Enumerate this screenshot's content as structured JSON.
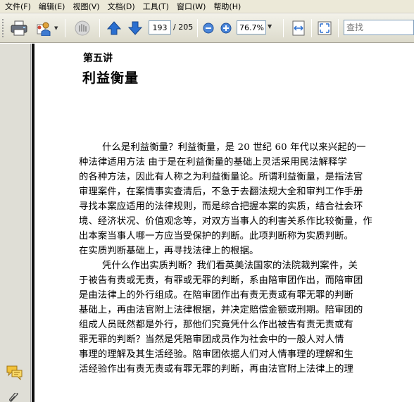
{
  "menu": [
    "文件(F)",
    "编辑(E)",
    "视图(V)",
    "文档(D)",
    "工具(T)",
    "窗口(W)",
    "帮助(H)"
  ],
  "toolbar": {
    "page_current": "193",
    "page_total": "/ 205",
    "zoom": "76.7%",
    "search_placeholder": "查找",
    "accent": "#2a6fd0"
  },
  "document": {
    "lecture_number": "第五讲",
    "lecture_title": "利益衡量",
    "lines": [
      "什么是利益衡量？利益衡量，是 20 世纪 60 年代以来兴起的一",
      "种法律适用方法   由于是在利益衡量的基础上灵活采用民法解释学",
      "的各种方法，因此有人称之为利益衡量论。所谓利益衡量，是指法官",
      "审理案件，在案情事实查清后，不急于去翻法规大全和审判工作手册",
      "寻找本案应适用的法律规则，而是综合把握本案的实质，结合社会环",
      "境、经济状况、价值观念等，对双方当事人的利害关系作比较衡量，作",
      "出本案当事人哪一方应当受保护的判断。此项判断称为实质判断。",
      "在实质判断基础上，再寻找法律上的根据。",
      "凭什么作出实质判断？我们看英美法国家的法院裁判案件，关",
      "于被告有责或无责，有罪或无罪的判断，系由陪审团作出，而陪审团",
      "是由法律上的外行组成。在陪审团作出有责无责或有罪无罪的判断",
      "基础上，再由法官附上法律根据，并决定赔偿金额或刑期。陪审团的",
      "组成人员既然都是外行，那他们究竟凭什么作出被告有责无责或有",
      "罪无罪的判断？当然是凭陪审团成员作为社会中的一般人对人情",
      "事理的理解及其生活经验。陪审团依据人们对人情事理的理解和生",
      "活经验作出有责无责或有罪无罪的判断，再由法官附上法律上的理"
    ]
  }
}
